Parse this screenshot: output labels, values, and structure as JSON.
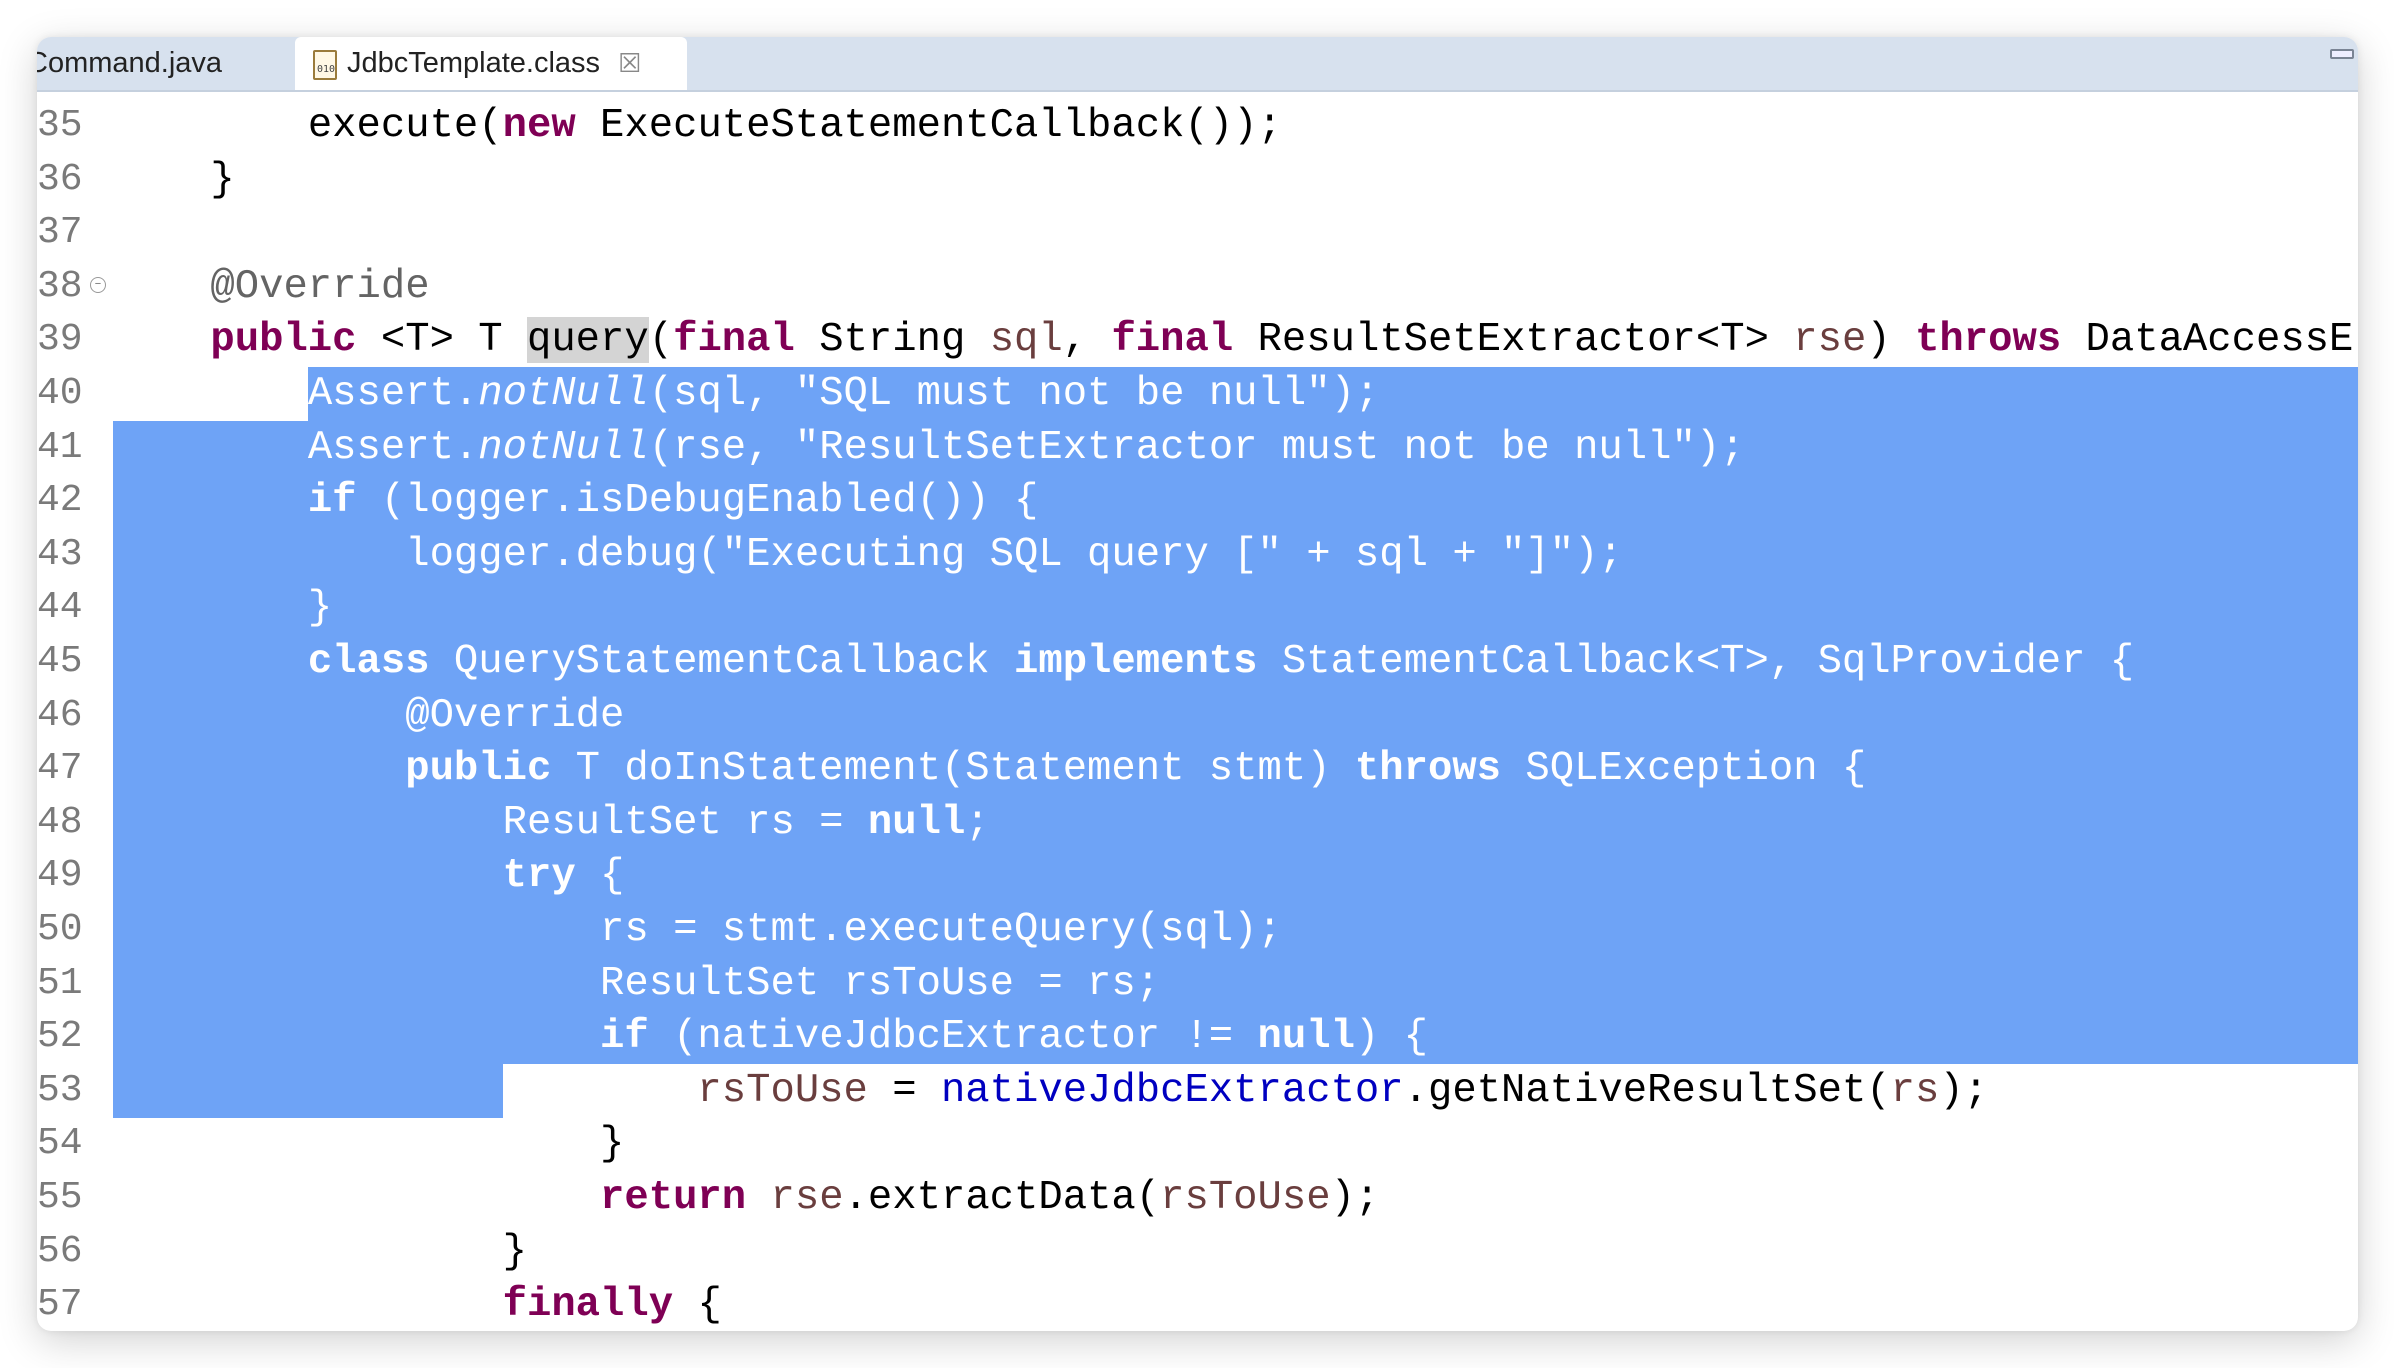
{
  "tabs": [
    {
      "label": "Command.java",
      "visible_label": "ommand.java",
      "active": false
    },
    {
      "label": "JdbcTemplate.class",
      "active": true,
      "icon": "class-file-icon",
      "close_icon": "close-icon"
    }
  ],
  "colors": {
    "selection": "#6ea3f6",
    "keyword": "#7f0055",
    "field": "#0000c0",
    "parameter": "#6a3e3e",
    "annotation": "#646464",
    "string": "#2a00ff",
    "tab_bar": "#d7e1ee"
  },
  "selection": {
    "start": {
      "line": 40,
      "col": 8
    },
    "end": {
      "line": 53,
      "col": 16
    }
  },
  "lines": [
    {
      "num": "35",
      "indent": 8,
      "tokens": [
        {
          "t": "execute("
        },
        {
          "t": "new",
          "c": "kw"
        },
        {
          "t": " ExecuteStatementCallback());"
        }
      ]
    },
    {
      "num": "36",
      "indent": 4,
      "tokens": [
        {
          "t": "}"
        }
      ]
    },
    {
      "num": "37",
      "indent": 0,
      "tokens": []
    },
    {
      "num": "38",
      "indent": 4,
      "fold": true,
      "tokens": [
        {
          "t": "@Override",
          "c": "annot"
        }
      ]
    },
    {
      "num": "39",
      "indent": 4,
      "tokens": [
        {
          "t": "public",
          "c": "kw"
        },
        {
          "t": " <T> T "
        },
        {
          "t": "query",
          "c": "hl"
        },
        {
          "t": "("
        },
        {
          "t": "final",
          "c": "kw"
        },
        {
          "t": " String "
        },
        {
          "t": "sql",
          "c": "param"
        },
        {
          "t": ", "
        },
        {
          "t": "final",
          "c": "kw"
        },
        {
          "t": " ResultSetExtractor<T> "
        },
        {
          "t": "rse",
          "c": "param"
        },
        {
          "t": ") "
        },
        {
          "t": "throws",
          "c": "kw"
        },
        {
          "t": " DataAccessE"
        }
      ]
    },
    {
      "num": "40",
      "indent": 8,
      "tokens": [
        {
          "t": "Assert."
        },
        {
          "t": "notNull",
          "c": "ital"
        },
        {
          "t": "(sql, "
        },
        {
          "t": "\"SQL must not be null\"",
          "c": "str"
        },
        {
          "t": ");"
        }
      ]
    },
    {
      "num": "41",
      "indent": 8,
      "tokens": [
        {
          "t": "Assert."
        },
        {
          "t": "notNull",
          "c": "ital"
        },
        {
          "t": "(rse, "
        },
        {
          "t": "\"ResultSetExtractor must not be null\"",
          "c": "str"
        },
        {
          "t": ");"
        }
      ]
    },
    {
      "num": "42",
      "indent": 8,
      "tokens": [
        {
          "t": "if",
          "c": "kw"
        },
        {
          "t": " (logger.isDebugEnabled()) {"
        }
      ]
    },
    {
      "num": "43",
      "indent": 12,
      "tokens": [
        {
          "t": "logger.debug("
        },
        {
          "t": "\"Executing SQL query [\"",
          "c": "str"
        },
        {
          "t": " + sql + "
        },
        {
          "t": "\"]\"",
          "c": "str"
        },
        {
          "t": ");"
        }
      ]
    },
    {
      "num": "44",
      "indent": 8,
      "tokens": [
        {
          "t": "}"
        }
      ]
    },
    {
      "num": "45",
      "indent": 8,
      "tokens": [
        {
          "t": "class",
          "c": "kw"
        },
        {
          "t": " QueryStatementCallback "
        },
        {
          "t": "implements",
          "c": "kw"
        },
        {
          "t": " StatementCallback<T>, SqlProvider {"
        }
      ]
    },
    {
      "num": "46",
      "indent": 12,
      "tokens": [
        {
          "t": "@Override",
          "c": "annot"
        }
      ]
    },
    {
      "num": "47",
      "indent": 12,
      "tokens": [
        {
          "t": "public",
          "c": "kw"
        },
        {
          "t": " T doInStatement(Statement stmt) "
        },
        {
          "t": "throws",
          "c": "kw"
        },
        {
          "t": " SQLException {"
        }
      ]
    },
    {
      "num": "48",
      "indent": 16,
      "tokens": [
        {
          "t": "ResultSet rs = "
        },
        {
          "t": "null",
          "c": "kw"
        },
        {
          "t": ";"
        }
      ]
    },
    {
      "num": "49",
      "indent": 16,
      "tokens": [
        {
          "t": "try",
          "c": "kw"
        },
        {
          "t": " {"
        }
      ]
    },
    {
      "num": "50",
      "indent": 20,
      "tokens": [
        {
          "t": "rs = stmt.executeQuery(sql);"
        }
      ]
    },
    {
      "num": "51",
      "indent": 20,
      "tokens": [
        {
          "t": "ResultSet rsToUse = rs;"
        }
      ]
    },
    {
      "num": "52",
      "indent": 20,
      "tokens": [
        {
          "t": "if",
          "c": "kw"
        },
        {
          "t": " (nativeJdbcExtractor != "
        },
        {
          "t": "null",
          "c": "kw"
        },
        {
          "t": ") {"
        }
      ]
    },
    {
      "num": "53",
      "indent": 24,
      "tokens": [
        {
          "t": "rsToUse",
          "c": "param"
        },
        {
          "t": " = "
        },
        {
          "t": "nativeJdbcExtractor",
          "c": "field"
        },
        {
          "t": ".getNativeResultSet("
        },
        {
          "t": "rs",
          "c": "param"
        },
        {
          "t": ");"
        }
      ]
    },
    {
      "num": "54",
      "indent": 20,
      "tokens": [
        {
          "t": "}"
        }
      ]
    },
    {
      "num": "55",
      "indent": 20,
      "tokens": [
        {
          "t": "return",
          "c": "kw"
        },
        {
          "t": " "
        },
        {
          "t": "rse",
          "c": "param"
        },
        {
          "t": ".extractData("
        },
        {
          "t": "rsToUse",
          "c": "param"
        },
        {
          "t": ");"
        }
      ]
    },
    {
      "num": "56",
      "indent": 16,
      "tokens": [
        {
          "t": "}"
        }
      ]
    },
    {
      "num": "57",
      "indent": 16,
      "tokens": [
        {
          "t": "finally",
          "c": "kw"
        },
        {
          "t": " {"
        }
      ]
    }
  ]
}
